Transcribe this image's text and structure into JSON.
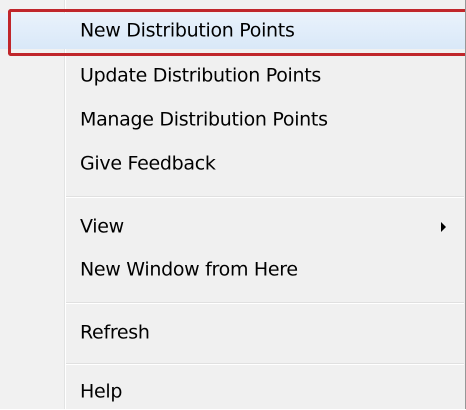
{
  "context_menu": {
    "items": [
      {
        "label": "New Distribution Points"
      },
      {
        "label": "Update Distribution Points"
      },
      {
        "label": "Manage Distribution Points"
      },
      {
        "label": "Give Feedback"
      },
      {
        "label": "View"
      },
      {
        "label": "New Window from Here"
      },
      {
        "label": "Refresh"
      },
      {
        "label": "Help"
      }
    ],
    "highlighted_item": "New Distribution Points",
    "highlight_border_color": "#c0262b",
    "submenu_arrow_icon": "triangle-right-icon"
  }
}
